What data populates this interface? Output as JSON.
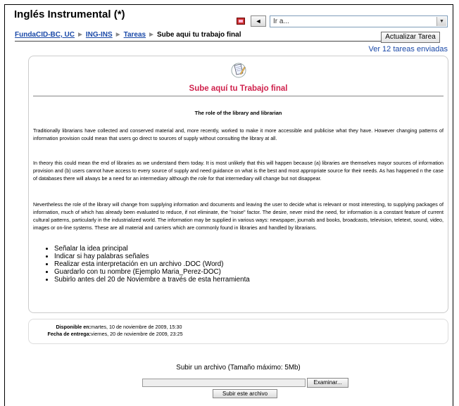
{
  "header": {
    "title": "Inglés Instrumental (*)",
    "prev_label": "◄",
    "jump_value": "Ir a..."
  },
  "breadcrumb": {
    "items": [
      "FundaCID-BC, UC",
      "ING-INS",
      "Tareas"
    ],
    "separator": "►",
    "current": "Sube aqui tu trabajo final"
  },
  "update_button": "Actualizar Tarea",
  "view_link": "Ver 12 tareas enviadas",
  "assignment": {
    "heading": "Sube aquí tu Trabajo final",
    "doc_title": "The role of the library and librarian",
    "paragraphs": [
      "Traditionally librarians have collected and conserved material and, more recently, worked to make it more accessible and publicise what they have. However changing patterns of information provision could mean that users go direct to sources of supply without consulting the library at all.",
      "In theory this could mean the end of libraries as we understand them today. It is most unlikely that this will happen because (a) libraries are themselves mayor sources of information provision and (b) users cannot have access to every source of supply and need guidance on what is the best and most appropriate source for their needs. As has happened n the case of databases there will always be a need for an intermediary although the role for that intermediary will change but not disappear.",
      "Nevertheless the role of the library will change from supplying information and documents and leaving the user to decide what is relevant or most interesting, to supplying packages of information, much of which has already been evaluated to reduce, if not eliminate, the \"noise\" factor. The desire, never mind the need, for information is a constant feature of current cultural patterns, particularly in the industrialized world. The information may be supplied in various ways: newspaper, journals and books, broadcasts, television, teletext, sound, video, images or on-line systems. These are all material and carriers which are commonly found in libraries and handled by librarians."
    ],
    "instructions": [
      "Señalar la idea principal",
      "Indicar si hay palabras señales",
      "Realizar esta interpretación en un archivo .DOC (Word)",
      "Guardarlo con tu nombre (Ejemplo Maria_Perez-DOC)",
      "Subirlo antes del 20 de Noviembre a través de esta herramienta"
    ]
  },
  "dates": {
    "available_label": "Disponible en:",
    "available_value": "martes, 10 de noviembre de 2009, 15:30",
    "due_label": "Fecha de entrega:",
    "due_value": "viernes, 20 de noviembre de 2009, 23:25"
  },
  "upload": {
    "label": "Subir un archivo (Tamaño máximo: 5Mb)",
    "browse_label": "Examinar...",
    "submit_label": "Subir este archivo"
  },
  "icons": {
    "nav": "page-icon",
    "assignment": "assignment-document-icon"
  }
}
